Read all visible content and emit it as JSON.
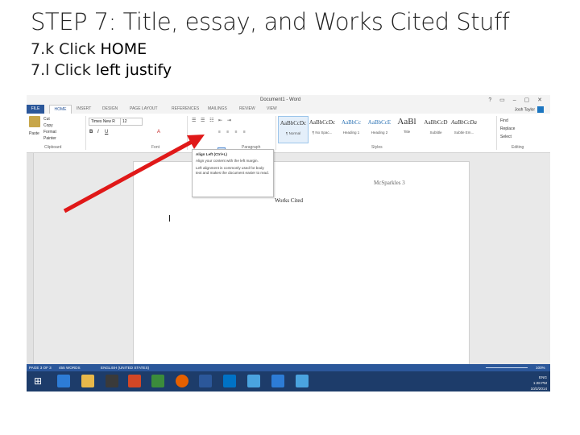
{
  "slide": {
    "title": "STEP 7: Title, essay, and Works Cited Stuff",
    "step1_prefix": "7.k Click ",
    "step1_target": "HOME",
    "step2_prefix": "7.l Click ",
    "step2_target": "left justify"
  },
  "word": {
    "window_title": "Document1 - Word",
    "window_controls": "? ▭ – ▢ ✕",
    "user_name": "Josh Taylor",
    "tabs": [
      "FILE",
      "HOME",
      "INSERT",
      "DESIGN",
      "PAGE LAYOUT",
      "REFERENCES",
      "MAILINGS",
      "REVIEW",
      "VIEW"
    ],
    "clipboard": {
      "paste": "Paste",
      "cut": "Cut",
      "copy": "Copy",
      "format_painter": "Format Painter",
      "label": "Clipboard"
    },
    "font": {
      "name": "Times New R",
      "size": "12",
      "label": "Font"
    },
    "paragraph_label": "Paragraph",
    "styles_label": "Styles",
    "editing_label": "Editing",
    "styles": [
      {
        "sample": "AaBbCcDc",
        "name": "¶ Normal"
      },
      {
        "sample": "AaBbCcDc",
        "name": "¶ No Spac..."
      },
      {
        "sample": "AaBbCc",
        "name": "Heading 1"
      },
      {
        "sample": "AaBbCcE",
        "name": "Heading 2"
      },
      {
        "sample": "AaBl",
        "name": "Title"
      },
      {
        "sample": "AaBbCcD",
        "name": "Subtitle"
      },
      {
        "sample": "AaBbCcDa",
        "name": "Subtle Em..."
      }
    ],
    "editing": {
      "find": "Find",
      "replace": "Replace",
      "select": "Select"
    },
    "tooltip": {
      "title": "Align Left (Ctrl+L)",
      "line1": "Align your content with the left margin.",
      "line2": "Left alignment is commonly used for body text and makes the document easier to read."
    },
    "document": {
      "header": "McSparkles 3",
      "heading": "Works Cited"
    },
    "status": {
      "page": "PAGE 3 OF 3",
      "words": "455 WORDS",
      "language": "ENGLISH (UNITED STATES)",
      "zoom": "100%"
    },
    "tray": {
      "lang": "ENG",
      "time": "1:28 PM",
      "date": "10/2/2014"
    }
  },
  "colors": {
    "word_blue": "#2b579a",
    "arrow_red": "#e01818",
    "taskbar": "#1d3c6a"
  }
}
